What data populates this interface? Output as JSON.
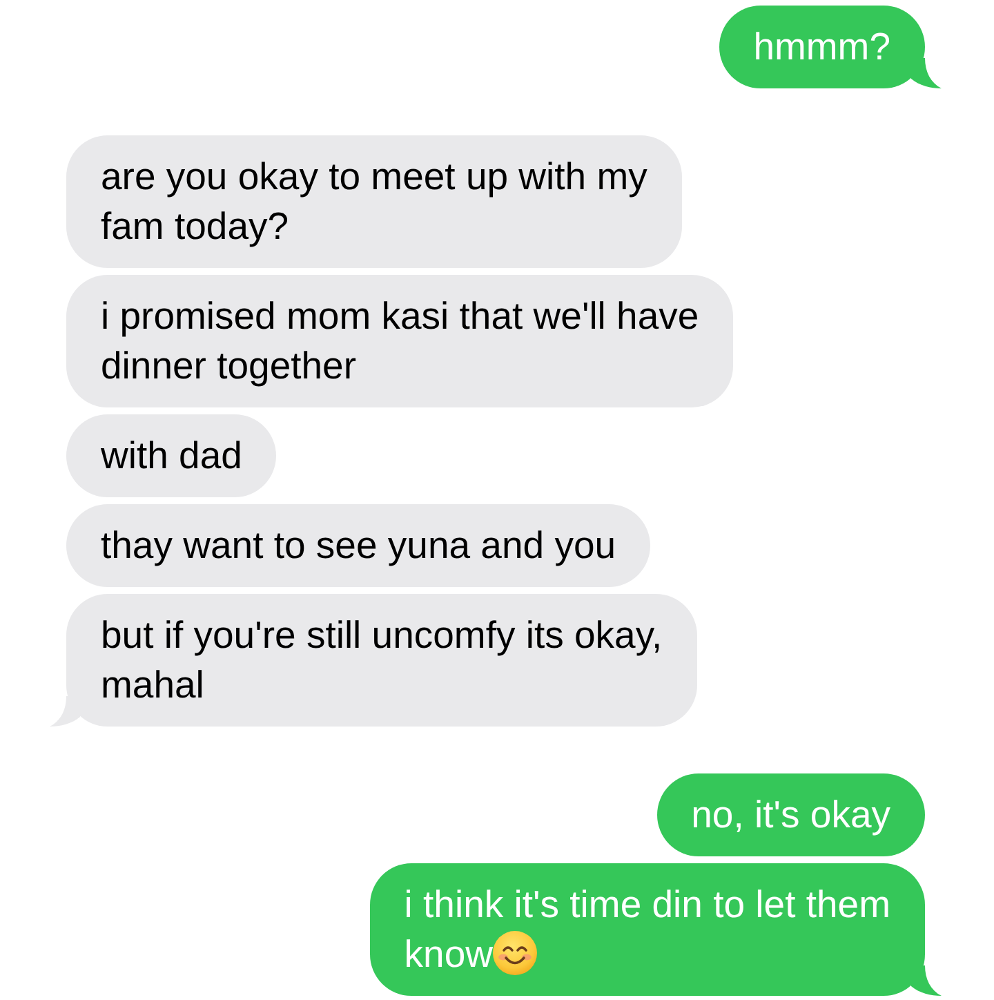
{
  "groups": [
    {
      "kind": "sent",
      "messages": [
        {
          "lines": [
            "hmmm?"
          ],
          "emoji": false
        }
      ]
    },
    {
      "kind": "received",
      "messages": [
        {
          "lines": [
            "are you okay to meet up with my",
            "fam today?"
          ],
          "emoji": false
        },
        {
          "lines": [
            "i promised mom kasi that we'll have",
            "dinner together"
          ],
          "emoji": false
        },
        {
          "lines": [
            "with dad"
          ],
          "emoji": false
        },
        {
          "lines": [
            "thay want to see yuna and you"
          ],
          "emoji": false
        },
        {
          "lines": [
            "but if you're still uncomfy its okay,",
            "mahal"
          ],
          "emoji": false
        }
      ]
    },
    {
      "kind": "sent",
      "messages": [
        {
          "lines": [
            "no, it's okay"
          ],
          "emoji": false
        },
        {
          "lines": [
            "i think it's time din to let them",
            "know"
          ],
          "emoji": true
        }
      ]
    }
  ]
}
